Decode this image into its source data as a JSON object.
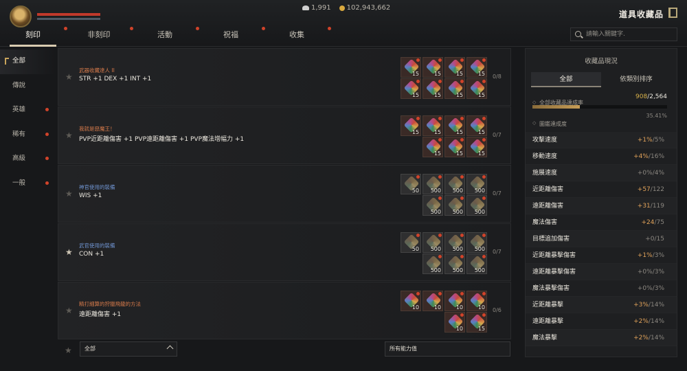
{
  "currency": {
    "wings": "1,991",
    "gold": "102,943,662"
  },
  "page_title": "道具收藏品",
  "tabs": [
    {
      "label": "刻印",
      "active": true
    },
    {
      "label": "非刻印",
      "active": false
    },
    {
      "label": "活動",
      "active": false
    },
    {
      "label": "祝福",
      "active": false
    },
    {
      "label": "收集",
      "active": false
    }
  ],
  "search": {
    "placeholder": "請輸入關鍵字."
  },
  "categories": [
    {
      "label": "全部",
      "active": true,
      "dot": false
    },
    {
      "label": "傳說",
      "active": false,
      "dot": false
    },
    {
      "label": "英雄",
      "active": false,
      "dot": true
    },
    {
      "label": "稀有",
      "active": false,
      "dot": true
    },
    {
      "label": "高級",
      "active": false,
      "dot": true
    },
    {
      "label": "一般",
      "active": false,
      "dot": true
    }
  ],
  "collections": [
    {
      "subtitle": "武器收藏達人 II",
      "subtitle_color": "#d77a4a",
      "stat": "STR +1 DEX +1 INT +1",
      "progress": "0/8",
      "fav": false,
      "items": [
        [
          "15",
          "15",
          "15",
          "15"
        ],
        [
          "15",
          "15",
          "15",
          "15"
        ]
      ],
      "gray": false
    },
    {
      "subtitle": "我就是惡魔王！",
      "subtitle_color": "#d77a4a",
      "stat": "PVP近距離傷害 +1 PVP遠距離傷害 +1 PVP魔法增幅力 +1",
      "progress": "0/7",
      "fav": false,
      "items": [
        [
          "15",
          "15",
          "15",
          "15"
        ],
        [
          "15",
          "15",
          "15"
        ]
      ],
      "gray": false
    },
    {
      "subtitle": "神官使用的裝備",
      "subtitle_color": "#6f93d0",
      "stat": "WIS +1",
      "progress": "0/7",
      "fav": false,
      "items": [
        [
          "50",
          "500",
          "500",
          "500"
        ],
        [
          "500",
          "500",
          "500"
        ]
      ],
      "gray": true
    },
    {
      "subtitle": "武官使用的裝備",
      "subtitle_color": "#6f93d0",
      "stat": "CON +1",
      "progress": "0/7",
      "fav": true,
      "items": [
        [
          "50",
          "500",
          "500",
          "500"
        ],
        [
          "500",
          "500",
          "500"
        ]
      ],
      "gray": true
    },
    {
      "subtitle": "精打細算的狩獵飛龍的方法",
      "subtitle_color": "#d77a4a",
      "stat": "遠距離傷害 +1",
      "progress": "0/6",
      "fav": false,
      "items": [
        [
          "10",
          "10",
          "10",
          "10"
        ],
        [
          "10",
          "15"
        ]
      ],
      "gray": false
    }
  ],
  "filters": {
    "left": "全部",
    "right": "所有能力值"
  },
  "panel": {
    "title": "收藏品現況",
    "tabs": [
      {
        "label": "全部",
        "active": true
      },
      {
        "label": "依類別排序",
        "active": false
      }
    ],
    "completion_label": "全部收藏品達成率",
    "completion_value": "908",
    "completion_total": "/2,564",
    "completion_pct": "35.41%",
    "completion_fraction": 0.3541,
    "effect_label": "圖鑑達成度",
    "stats": [
      {
        "name": "攻擊速度",
        "value": "+1%",
        "max": "/5%",
        "gold": true
      },
      {
        "name": "移動速度",
        "value": "+4%",
        "max": "/16%",
        "gold": true
      },
      {
        "name": "施展速度",
        "value": "+0%",
        "max": "/4%",
        "gold": false
      },
      {
        "name": "近距離傷害",
        "value": "+57",
        "max": "/122",
        "gold": true
      },
      {
        "name": "遠距離傷害",
        "value": "+31",
        "max": "/119",
        "gold": true
      },
      {
        "name": "魔法傷害",
        "value": "+24",
        "max": "/75",
        "gold": true
      },
      {
        "name": "目標追加傷害",
        "value": "+0",
        "max": "/15",
        "gold": false
      },
      {
        "name": "近距離暴擊傷害",
        "value": "+1%",
        "max": "/3%",
        "gold": true
      },
      {
        "name": "遠距離暴擊傷害",
        "value": "+0%",
        "max": "/3%",
        "gold": false
      },
      {
        "name": "魔法暴擊傷害",
        "value": "+0%",
        "max": "/3%",
        "gold": false
      },
      {
        "name": "近距離暴擊",
        "value": "+3%",
        "max": "/14%",
        "gold": true
      },
      {
        "name": "遠距離暴擊",
        "value": "+2%",
        "max": "/14%",
        "gold": true
      },
      {
        "name": "魔法暴擊",
        "value": "+2%",
        "max": "/14%",
        "gold": true
      }
    ]
  }
}
